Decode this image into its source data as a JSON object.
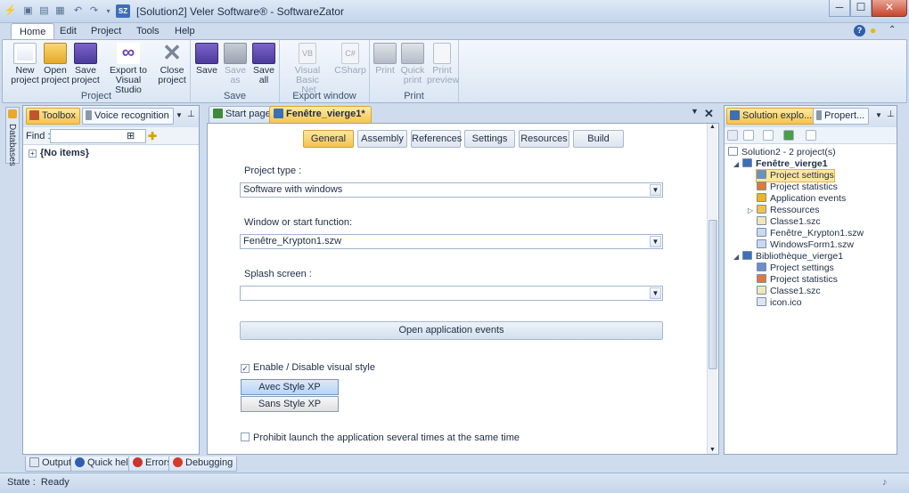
{
  "window": {
    "title": "[Solution2] Veler Software® - SoftwareZator",
    "min": "─",
    "max": "☐",
    "close": "✕"
  },
  "ribbon_tabs": [
    "Home",
    "Edit",
    "Project",
    "Tools",
    "Help"
  ],
  "ribbon": {
    "groups": [
      {
        "label": "Project",
        "buttons": [
          "New project",
          "Open project",
          "Save project",
          "Export to Visual Studio",
          "Close project"
        ]
      },
      {
        "label": "Save",
        "buttons": [
          "Save",
          "Save as",
          "Save all"
        ]
      },
      {
        "label": "Export window",
        "buttons": [
          "Visual Basic .Net",
          "CSharp"
        ]
      },
      {
        "label": "Print",
        "buttons": [
          "Print",
          "Quick print",
          "Print preview"
        ]
      }
    ],
    "new_label": "New\nproject",
    "open_label": "Open\nproject",
    "saveproj_label": "Save\nproject",
    "export_label": "Export to\nVisual Studio",
    "close_label": "Close\nproject",
    "save_label": "Save",
    "saveas_label": "Save\nas",
    "saveall_label": "Save\nall",
    "vb_label": "Visual Basic\n.Net",
    "cs_label": "CSharp",
    "print_label": "Print",
    "qprint_label": "Quick\nprint",
    "preview_label": "Print\npreview"
  },
  "left_panel": {
    "vertical_tab": "Databases",
    "tabs": [
      "Toolbox",
      "Voice recognition"
    ],
    "find_label": "Find :",
    "find_value": "",
    "no_items": "{No items}"
  },
  "doc_tabs": [
    "Start page",
    "Fenêtre_vierge1*"
  ],
  "sub_tabs": [
    "General",
    "Assembly",
    "References",
    "Settings",
    "Resources",
    "Build"
  ],
  "form": {
    "project_type_label": "Project type :",
    "project_type_value": "Software with windows",
    "window_label": "Window or start function:",
    "window_value": "Fenêtre_Krypton1.szw",
    "splash_label": "Splash screen :",
    "splash_value": "",
    "open_events": "Open application events",
    "visual_style_label": "Enable / Disable visual style",
    "visual_style_checked": true,
    "style_xp": "Avec Style XP",
    "style_no_xp": "Sans Style XP",
    "prohibit_label": "Prohibit launch the application several times at the same time",
    "prohibit_checked": false
  },
  "right_panel": {
    "tabs": [
      "Solution explo...",
      "Propert..."
    ],
    "tree": [
      {
        "label": "Solution2 - 2 project(s)",
        "level": 0,
        "icon": "solution-icon"
      },
      {
        "label": "Fenêtre_vierge1",
        "level": 1,
        "icon": "sz-project-icon",
        "bold": true
      },
      {
        "label": "Project settings",
        "level": 2,
        "icon": "settings-icon",
        "selected": true
      },
      {
        "label": "Project statistics",
        "level": 2,
        "icon": "statistics-icon"
      },
      {
        "label": "Application events",
        "level": 2,
        "icon": "events-icon"
      },
      {
        "label": "Ressources",
        "level": 2,
        "icon": "folder-icon"
      },
      {
        "label": "Classe1.szc",
        "level": 2,
        "icon": "class-file-icon"
      },
      {
        "label": "Fenêtre_Krypton1.szw",
        "level": 2,
        "icon": "window-file-icon"
      },
      {
        "label": "WindowsForm1.szw",
        "level": 2,
        "icon": "window-file-icon"
      },
      {
        "label": "Bibliothèque_vierge1",
        "level": 1,
        "icon": "sz-project-icon"
      },
      {
        "label": "Project settings",
        "level": 2,
        "icon": "settings-icon"
      },
      {
        "label": "Project statistics",
        "level": 2,
        "icon": "statistics-icon"
      },
      {
        "label": "Classe1.szc",
        "level": 2,
        "icon": "class-file-icon"
      },
      {
        "label": "icon.ico",
        "level": 2,
        "icon": "ico-file-icon"
      }
    ]
  },
  "bottom_tabs": [
    "Output",
    "Quick help",
    "Errors",
    "Debugging"
  ],
  "status": {
    "text": "State :  Ready"
  },
  "colors": {
    "accent": "#f7c54f",
    "border": "#8ea5c4",
    "ribbon": "#dbe6f3"
  }
}
